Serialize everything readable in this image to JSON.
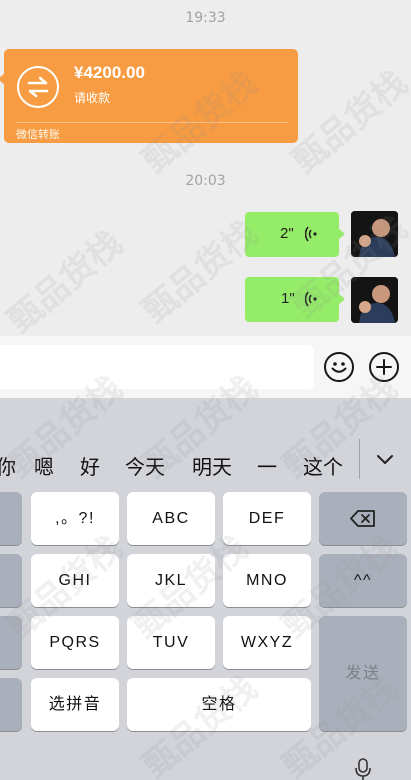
{
  "chat": {
    "timestamps": [
      "19:33",
      "20:03"
    ],
    "transfer": {
      "amount": "¥4200.00",
      "status": "请收款",
      "source": "微信转账",
      "icon": "transfer-arrows-icon"
    },
    "voice_messages": [
      {
        "duration": "2\"",
        "icon": "voice-wave-icon"
      },
      {
        "duration": "1\"",
        "icon": "voice-wave-icon"
      }
    ]
  },
  "input_bar": {
    "emoji_icon": "emoji-icon",
    "plus_icon": "plus-icon"
  },
  "keyboard": {
    "candidates": [
      "你",
      "嗯",
      "好",
      "今天",
      "明天",
      "一",
      "这个"
    ],
    "keys": {
      "punct": ",。?!",
      "abc": "ABC",
      "def": "DEF",
      "ghi": "GHI",
      "jkl": "JKL",
      "mno": "MNO",
      "pqrs": "PQRS",
      "tuv": "TUV",
      "wxyz": "WXYZ",
      "pinyin": "选拼音",
      "space": "空格",
      "caret": "^^",
      "send": "发送"
    }
  },
  "watermark": "甄品货栈",
  "colors": {
    "chat_bg": "#ededed",
    "transfer_orange": "#f79c42",
    "voice_green": "#95ec69",
    "keyboard_bg": "#d2d4da"
  }
}
